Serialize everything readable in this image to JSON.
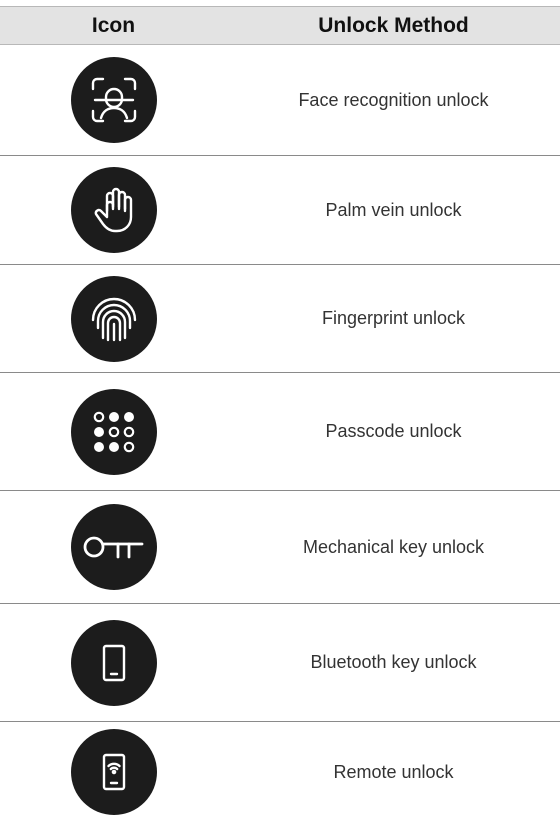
{
  "header": {
    "icon_col": "Icon",
    "method_col": "Unlock Method"
  },
  "rows": [
    {
      "label": "Face recognition unlock",
      "icon": "face-recognition-icon"
    },
    {
      "label": "Palm vein unlock",
      "icon": "palm-icon"
    },
    {
      "label": "Fingerprint unlock",
      "icon": "fingerprint-icon"
    },
    {
      "label": "Passcode unlock",
      "icon": "keypad-icon"
    },
    {
      "label": "Mechanical key unlock",
      "icon": "key-icon"
    },
    {
      "label": "Bluetooth key unlock",
      "icon": "phone-icon"
    },
    {
      "label": "Remote unlock",
      "icon": "remote-phone-icon"
    }
  ],
  "colors": {
    "icon_circle": "#1c1c1c",
    "header_bg": "#e3e3e3",
    "text": "#333333"
  }
}
